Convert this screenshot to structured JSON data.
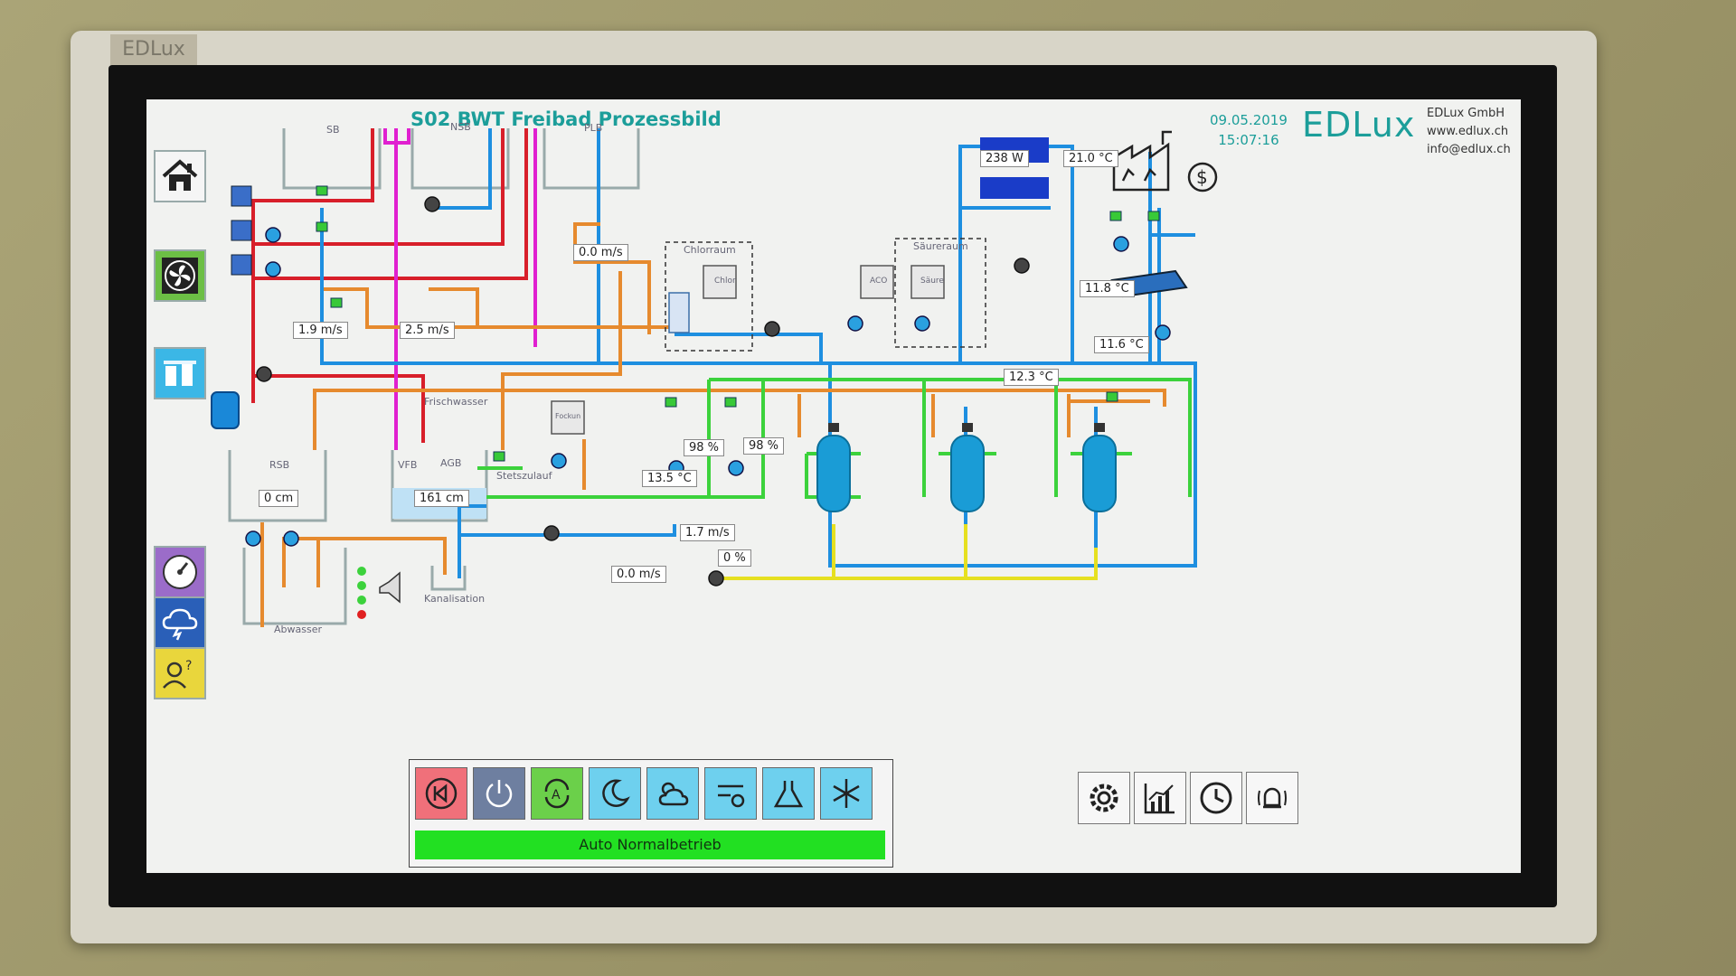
{
  "bezel_logo": "EDLux",
  "header": {
    "title": "S02 BWT Freibad  Prozessbild",
    "date": "09.05.2019",
    "time": "15:07:16",
    "brand": "EDLux",
    "company_name": "EDLux GmbH",
    "company_web": "www.edlux.ch",
    "company_mail": "info@edlux.ch"
  },
  "tanks": {
    "sb": "SB",
    "nsb": "NSB",
    "plb": "PLB",
    "rsb": "RSB",
    "vfb": "VFB",
    "agb": "AGB",
    "abwasser": "Abwasser",
    "kanalisation": "Kanalisation",
    "frischwasser": "Frischwasser",
    "stetszulauf": "Stetszulauf",
    "chlorraum": "Chlorraum",
    "saeureraum": "Säureraum",
    "chlor": "Chlor",
    "saeure": "Säure",
    "aco": "ACO",
    "fockun": "Fockun"
  },
  "readings": {
    "v1": "1.9 m/s",
    "v2": "2.5 m/s",
    "v3": "0.0 m/s",
    "rsb_level": "0 cm",
    "agb_level": "161 cm",
    "v4": "1.7 m/s",
    "v5": "0.0 m/s",
    "temp1": "13.5 °C",
    "pct1": "98 %",
    "pct2": "98 %",
    "pct3": "0 %",
    "temp2": "12.3 °C",
    "temp3": "11.8 °C",
    "temp4": "11.6 °C",
    "power": "238 W",
    "temp5": "21.0 °C"
  },
  "status": {
    "mode": "Auto Normalbetrieb"
  },
  "colors": {
    "accent": "#1c9e9a",
    "pipe_blue": "#1e8fe0",
    "pipe_red": "#d81f2a",
    "pipe_magenta": "#e020d0",
    "pipe_orange": "#e68a2e",
    "pipe_green": "#3cd23c",
    "pipe_yellow": "#e6e020",
    "status_green": "#22e022"
  }
}
